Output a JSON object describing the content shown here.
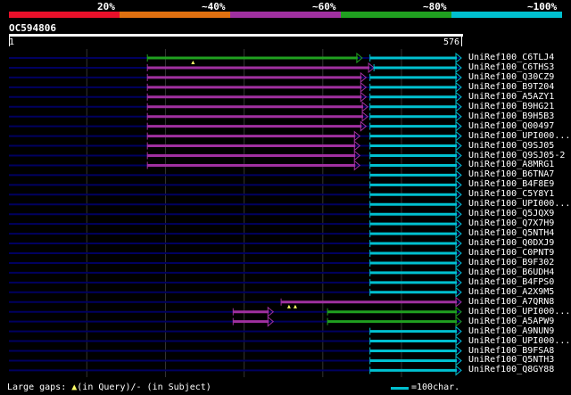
{
  "legend": {
    "labels": [
      "20%",
      "~40%",
      "~60%",
      "~80%",
      "~100%"
    ],
    "colors": [
      "#e8102a",
      "#e07010",
      "#a030a0",
      "#20a020",
      "#00c0d0"
    ]
  },
  "query": {
    "title": "OC594806",
    "start": "1",
    "end": "576"
  },
  "colors": {
    "grid": "#333333",
    "track": "#000060",
    "gap_marker": "#ffff66"
  },
  "hits": [
    {
      "label": "UniRef100_C6TLJ4",
      "segs": [
        [
          177,
          450,
          "#20a020"
        ],
        [
          460,
          576,
          "#00c0d0"
        ]
      ],
      "gaps": [
        235
      ]
    },
    {
      "label": "UniRef100_C6THS3",
      "segs": [
        [
          177,
          465,
          "#a030a0"
        ],
        [
          465,
          576,
          "#00c0d0"
        ]
      ],
      "gaps": []
    },
    {
      "label": "UniRef100_Q30CZ9",
      "segs": [
        [
          177,
          455,
          "#a030a0"
        ],
        [
          460,
          576,
          "#00c0d0"
        ]
      ],
      "gaps": []
    },
    {
      "label": "UniRef100_B9T204",
      "segs": [
        [
          177,
          455,
          "#a030a0"
        ],
        [
          460,
          576,
          "#00c0d0"
        ]
      ],
      "gaps": []
    },
    {
      "label": "UniRef100_A5AZY1",
      "segs": [
        [
          177,
          455,
          "#a030a0"
        ],
        [
          460,
          576,
          "#00c0d0"
        ]
      ],
      "gaps": []
    },
    {
      "label": "UniRef100_B9HG21",
      "segs": [
        [
          177,
          457,
          "#a030a0"
        ],
        [
          460,
          576,
          "#00c0d0"
        ]
      ],
      "gaps": []
    },
    {
      "label": "UniRef100_B9H5B3",
      "segs": [
        [
          177,
          457,
          "#a030a0"
        ],
        [
          460,
          576,
          "#00c0d0"
        ]
      ],
      "gaps": []
    },
    {
      "label": "UniRef100_Q00497",
      "segs": [
        [
          177,
          455,
          "#a030a0"
        ],
        [
          460,
          576,
          "#00c0d0"
        ]
      ],
      "gaps": []
    },
    {
      "label": "UniRef100_UPI000...",
      "segs": [
        [
          177,
          447,
          "#a030a0"
        ],
        [
          460,
          576,
          "#00c0d0"
        ]
      ],
      "gaps": []
    },
    {
      "label": "UniRef100_Q9SJ05",
      "segs": [
        [
          177,
          447,
          "#a030a0"
        ],
        [
          460,
          576,
          "#00c0d0"
        ]
      ],
      "gaps": []
    },
    {
      "label": "UniRef100_Q9SJ05-2",
      "segs": [
        [
          177,
          447,
          "#a030a0"
        ],
        [
          460,
          576,
          "#00c0d0"
        ]
      ],
      "gaps": []
    },
    {
      "label": "UniRef100_A8MRG1",
      "segs": [
        [
          177,
          447,
          "#a030a0"
        ],
        [
          460,
          576,
          "#00c0d0"
        ]
      ],
      "gaps": []
    },
    {
      "label": "UniRef100_B6TNA7",
      "segs": [
        [
          460,
          576,
          "#00c0d0"
        ]
      ],
      "gaps": []
    },
    {
      "label": "UniRef100_B4F8E9",
      "segs": [
        [
          460,
          576,
          "#00c0d0"
        ]
      ],
      "gaps": []
    },
    {
      "label": "UniRef100_C5Y8Y1",
      "segs": [
        [
          460,
          576,
          "#00c0d0"
        ]
      ],
      "gaps": []
    },
    {
      "label": "UniRef100_UPI000...",
      "segs": [
        [
          460,
          576,
          "#00c0d0"
        ]
      ],
      "gaps": []
    },
    {
      "label": "UniRef100_Q5JQX9",
      "segs": [
        [
          460,
          576,
          "#00c0d0"
        ]
      ],
      "gaps": []
    },
    {
      "label": "UniRef100_Q7X7H9",
      "segs": [
        [
          460,
          576,
          "#00c0d0"
        ]
      ],
      "gaps": []
    },
    {
      "label": "UniRef100_Q5NTH4",
      "segs": [
        [
          460,
          576,
          "#00c0d0"
        ]
      ],
      "gaps": []
    },
    {
      "label": "UniRef100_Q0DXJ9",
      "segs": [
        [
          460,
          576,
          "#00c0d0"
        ]
      ],
      "gaps": []
    },
    {
      "label": "UniRef100_C0PNT9",
      "segs": [
        [
          460,
          576,
          "#00c0d0"
        ]
      ],
      "gaps": []
    },
    {
      "label": "UniRef100_B9F302",
      "segs": [
        [
          460,
          576,
          "#00c0d0"
        ]
      ],
      "gaps": []
    },
    {
      "label": "UniRef100_B6UDH4",
      "segs": [
        [
          460,
          576,
          "#00c0d0"
        ]
      ],
      "gaps": []
    },
    {
      "label": "UniRef100_B4FPS0",
      "segs": [
        [
          460,
          576,
          "#00c0d0"
        ]
      ],
      "gaps": []
    },
    {
      "label": "UniRef100_A2X9M5",
      "segs": [
        [
          460,
          576,
          "#00c0d0"
        ]
      ],
      "gaps": []
    },
    {
      "label": "UniRef100_A7QRN8",
      "segs": [
        [
          347,
          576,
          "#a030a0"
        ]
      ],
      "gaps": [
        357,
        365
      ]
    },
    {
      "label": "UniRef100_UPI000...",
      "segs": [
        [
          286,
          337,
          "#a030a0"
        ],
        [
          406,
          576,
          "#20a020"
        ]
      ],
      "gaps": []
    },
    {
      "label": "UniRef100_A5APW9",
      "segs": [
        [
          286,
          337,
          "#a030a0"
        ],
        [
          406,
          576,
          "#20a020"
        ]
      ],
      "gaps": []
    },
    {
      "label": "UniRef100_A9NUN9",
      "segs": [
        [
          460,
          576,
          "#00c0d0"
        ]
      ],
      "gaps": []
    },
    {
      "label": "UniRef100_UPI000...",
      "segs": [
        [
          460,
          576,
          "#00c0d0"
        ]
      ],
      "gaps": []
    },
    {
      "label": "UniRef100_B9FSA8",
      "segs": [
        [
          460,
          576,
          "#00c0d0"
        ]
      ],
      "gaps": []
    },
    {
      "label": "UniRef100_Q5NTH3",
      "segs": [
        [
          460,
          576,
          "#00c0d0"
        ]
      ],
      "gaps": []
    },
    {
      "label": "UniRef100_Q8GY88",
      "segs": [
        [
          460,
          576,
          "#00c0d0"
        ]
      ],
      "gaps": []
    }
  ],
  "footer": {
    "text_a": "Large gaps: ",
    "text_b": "(in Query)/- (in Subject)",
    "scale_text": "=100char."
  }
}
